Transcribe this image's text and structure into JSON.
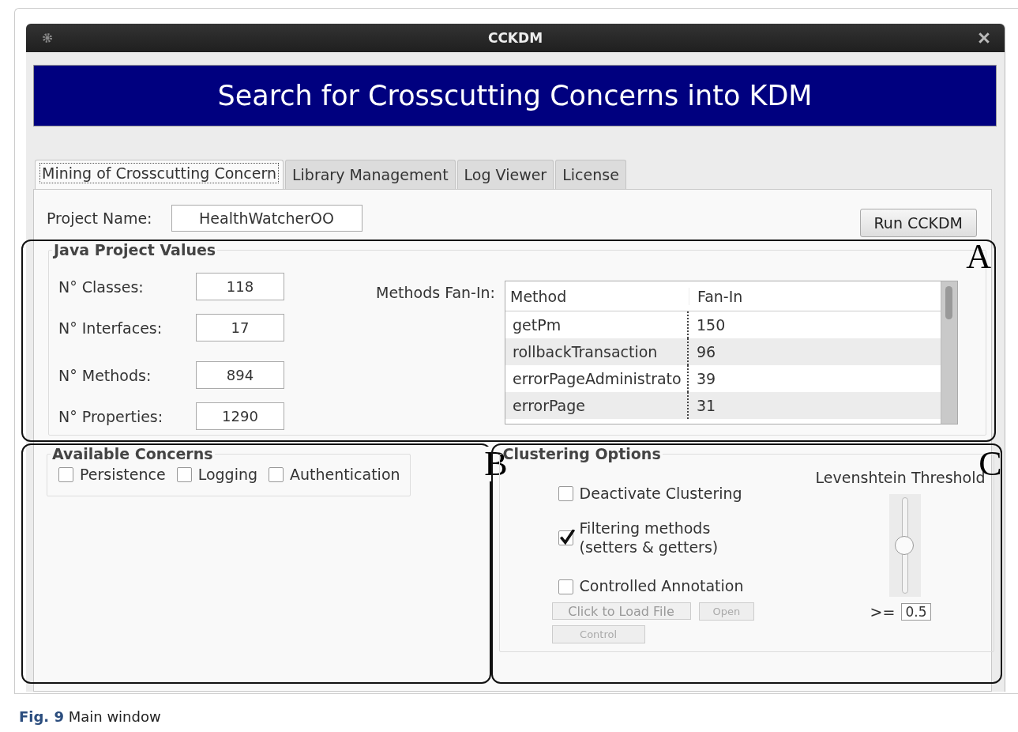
{
  "window": {
    "title": "CCKDM"
  },
  "banner": "Search for Crosscutting Concerns into KDM",
  "tabs": [
    {
      "label": "Mining of Crosscutting Concern",
      "selected": true
    },
    {
      "label": "Library Management",
      "selected": false
    },
    {
      "label": "Log Viewer",
      "selected": false
    },
    {
      "label": "License",
      "selected": false
    }
  ],
  "project": {
    "label": "Project Name:",
    "value": "HealthWatcherOO"
  },
  "run_button": "Run CCKDM",
  "java_values": {
    "title": "Java Project Values",
    "fields": [
      {
        "label": "N° Classes:",
        "value": "118"
      },
      {
        "label": "N° Interfaces:",
        "value": "17"
      },
      {
        "label": "N° Methods:",
        "value": "894"
      },
      {
        "label": "N° Properties:",
        "value": "1290"
      }
    ],
    "fan_in_label": "Methods Fan-In:",
    "table": {
      "columns": [
        "Method",
        "Fan-In"
      ],
      "rows": [
        [
          "getPm",
          "150"
        ],
        [
          "rollbackTransaction",
          "96"
        ],
        [
          "errorPageAdministrato",
          "39"
        ],
        [
          "errorPage",
          "31"
        ]
      ]
    }
  },
  "concerns": {
    "title": "Available Concerns",
    "items": [
      {
        "label": "Persistence",
        "checked": false
      },
      {
        "label": "Logging",
        "checked": false
      },
      {
        "label": "Authentication",
        "checked": false
      }
    ]
  },
  "clustering": {
    "title": "Clustering Options",
    "options": [
      {
        "label": "Deactivate Clustering",
        "checked": false
      },
      {
        "label": "Filtering methods\n(setters & getters)",
        "checked": true
      },
      {
        "label": "Controlled Annotation",
        "checked": false
      }
    ],
    "file_button": {
      "label": "Click to Load File",
      "disabled": true
    },
    "open_button": {
      "label": "Open",
      "disabled": true
    },
    "control_button": {
      "label": "Control",
      "disabled": true
    },
    "threshold": {
      "title": "Levenshtein Threshold",
      "level": 0.5,
      "operator": ">=",
      "value": "0.5"
    }
  },
  "annotations": [
    "A",
    "B",
    "C"
  ],
  "caption": {
    "label": "Fig. 9",
    "text": "Main window"
  }
}
